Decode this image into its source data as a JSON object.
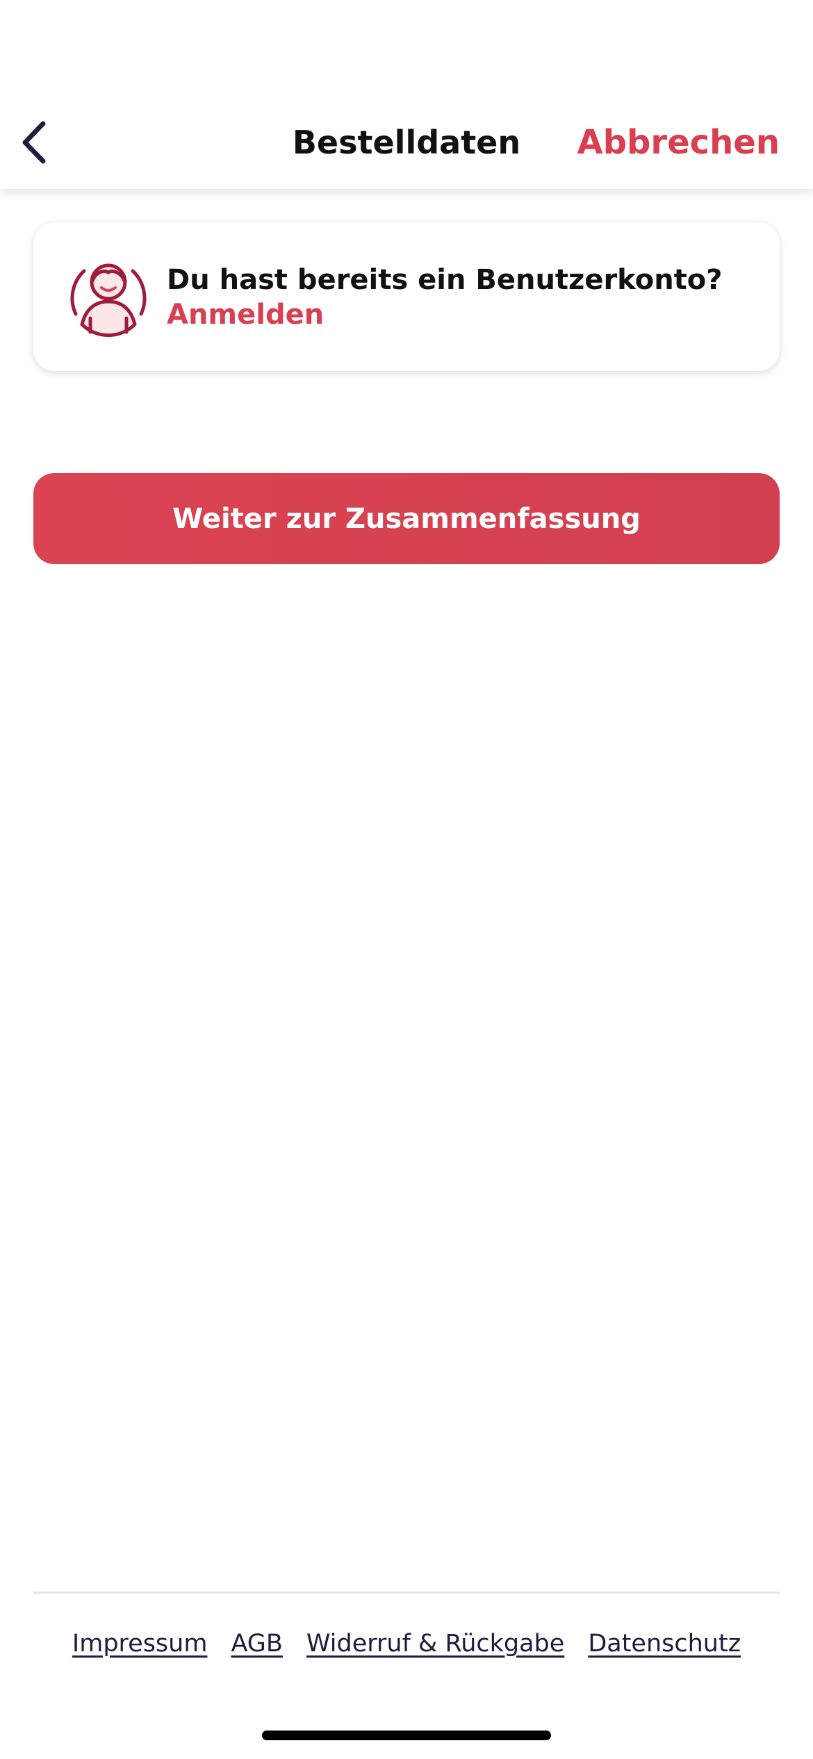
{
  "status_bar": {
    "indicator_color": "#ee1aee"
  },
  "nav": {
    "back_icon": "chevron-left-icon",
    "title": "Bestelldaten",
    "cancel_label": "Abbrechen"
  },
  "login_card": {
    "icon": "user-avatar-icon",
    "question": "Du hast bereits ein Benutzerkonto?",
    "link_label": "Anmelden"
  },
  "continue_button": {
    "label": "Weiter zur Zusammenfassung"
  },
  "footer": {
    "links": [
      {
        "label": "Impressum"
      },
      {
        "label": "AGB"
      },
      {
        "label": "Widerruf & Rückgabe"
      },
      {
        "label": "Datenschutz"
      }
    ]
  },
  "colors": {
    "accent": "#d93f50",
    "icon_dark": "#9e1d3c",
    "icon_fill": "#fbe6e8",
    "nav_icon": "#1d1d40",
    "text": "#111111"
  }
}
